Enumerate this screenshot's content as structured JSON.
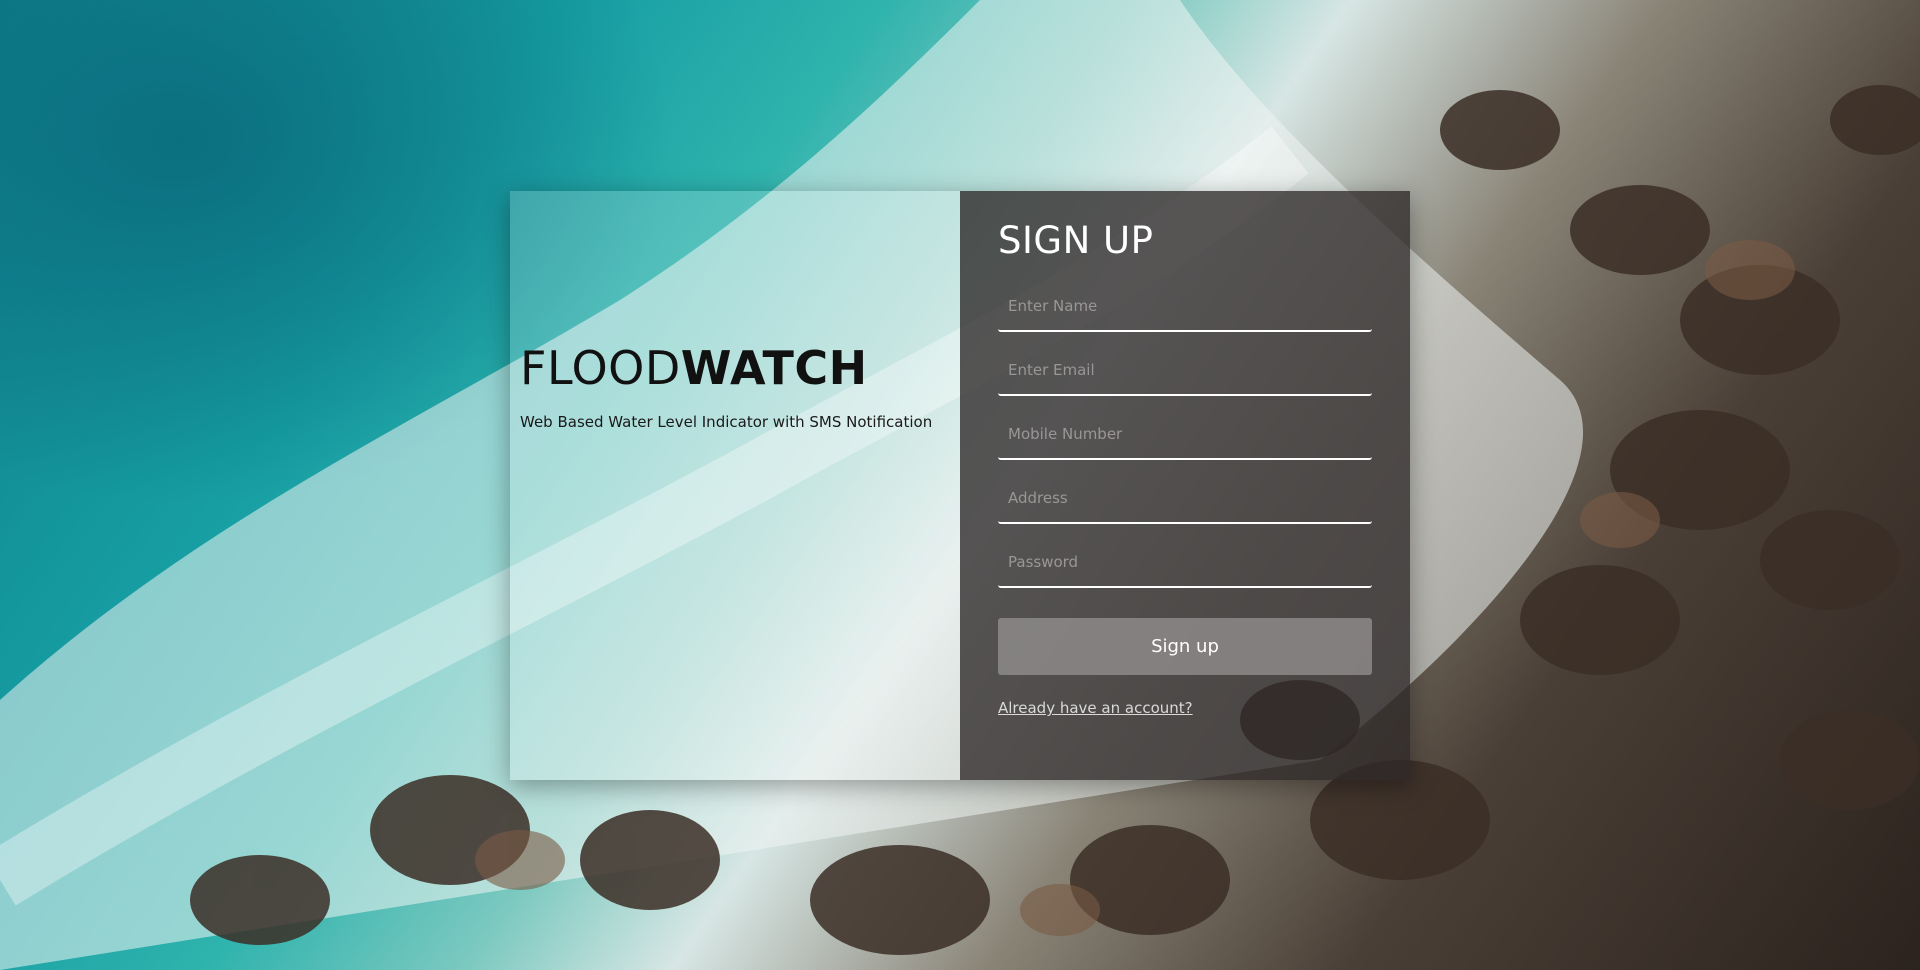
{
  "brand": {
    "name_light": "FLOOD",
    "name_bold": "WATCH",
    "tagline": "Web Based Water Level Indicator with SMS Notification"
  },
  "signup": {
    "title": "SIGN UP",
    "fields": {
      "name_placeholder": "Enter Name",
      "email_placeholder": "Enter Email",
      "mobile_placeholder": "Mobile Number",
      "address_placeholder": "Address",
      "password_placeholder": "Password"
    },
    "button_label": "Sign up",
    "login_link": "Already have an account?"
  },
  "colors": {
    "panel_dark": "#2d2828",
    "text_white": "#ffffff",
    "brand_text": "#111111",
    "button": "#969191"
  }
}
